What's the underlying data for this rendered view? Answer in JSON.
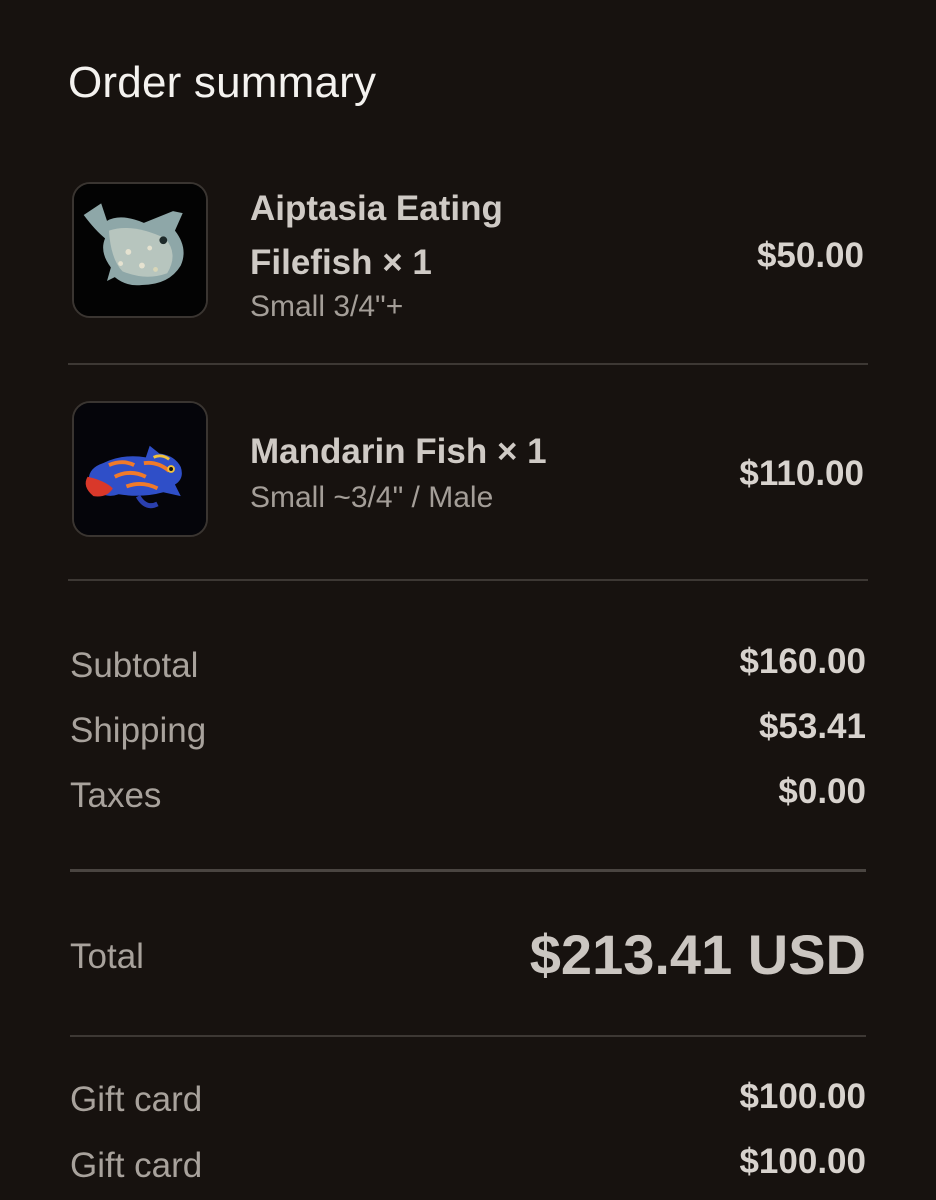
{
  "summary": {
    "title": "Order summary"
  },
  "items": [
    {
      "name_line1": "Aiptasia Eating",
      "name_line2": "Filefish × 1",
      "variant": "Small 3/4\"+",
      "price": "$50.00",
      "image_icon": "filefish-image"
    },
    {
      "name": "Mandarin Fish × 1",
      "variant": "Small ~3/4\" / Male",
      "price": "$110.00",
      "image_icon": "mandarin-fish-image"
    }
  ],
  "costs": {
    "subtotal_label": "Subtotal",
    "subtotal_value": "$160.00",
    "shipping_label": "Shipping",
    "shipping_value": "$53.41",
    "taxes_label": "Taxes",
    "taxes_value": "$0.00"
  },
  "total": {
    "label": "Total",
    "value": "$213.41 USD"
  },
  "gift_cards": [
    {
      "label": "Gift card",
      "value": "$100.00"
    },
    {
      "label": "Gift card",
      "value": "$100.00"
    }
  ],
  "colors": {
    "background": "#17120f",
    "divider": "#3d3834"
  }
}
